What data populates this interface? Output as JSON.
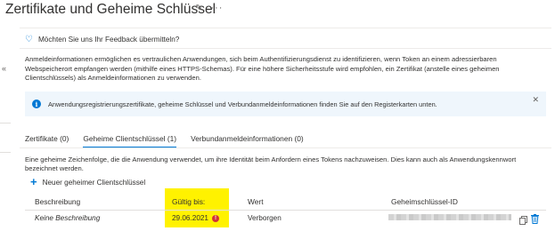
{
  "page": {
    "title": "Zertifikate und Geheime Schlüssel",
    "pin_glyph": "✎",
    "more_glyph": "···"
  },
  "nav": {
    "collapse_glyph": "«"
  },
  "feedback": {
    "label": "Möchten Sie uns Ihr Feedback übermitteln?",
    "icon": "heart-icon"
  },
  "description": "Anmeldeinformationen ermöglichen es vertraulichen Anwendungen, sich beim Authentifizierungsdienst zu identifizieren, wenn Token an einem adressierbaren Webspeicherort empfangen werden (mithilfe eines HTTPS-Schemas). Für eine höhere Sicherheitsstufe wird empfohlen, ein Zertifikat (anstelle eines geheimen Clientschlüssels) als Anmeldeinformationen zu verwenden.",
  "info_banner": {
    "text": "Anwendungsregistrierungszertifikate, geheime Schlüssel und Verbundanmeldeinformationen finden Sie auf den Registerkarten unten.",
    "icon_glyph": "i",
    "close_glyph": "✕"
  },
  "tabs": [
    {
      "label": "Zertifikate (0)",
      "active": false
    },
    {
      "label": "Geheime Clientschlüssel (1)",
      "active": true
    },
    {
      "label": "Verbundanmeldeinformationen (0)",
      "active": false
    }
  ],
  "secrets": {
    "description": "Eine geheime Zeichenfolge, die die Anwendung verwendet, um ihre Identität beim Anfordern eines Tokens nachzuweisen. Dies kann auch als Anwendungskennwort bezeichnet werden.",
    "add_label": "Neuer geheimer Clientschlüssel",
    "plus_glyph": "+",
    "columns": [
      "Beschreibung",
      "Gültig bis:",
      "Wert",
      "Geheimschlüssel-ID"
    ],
    "rows": [
      {
        "description": "Keine Beschreibung",
        "expires": "29.06.2021",
        "warning_glyph": "!",
        "value": "Verborgen"
      }
    ]
  },
  "colors": {
    "accent": "#0078d4",
    "highlight": "#fff200",
    "warning": "#d13438",
    "info_bg": "#eff6fc"
  }
}
